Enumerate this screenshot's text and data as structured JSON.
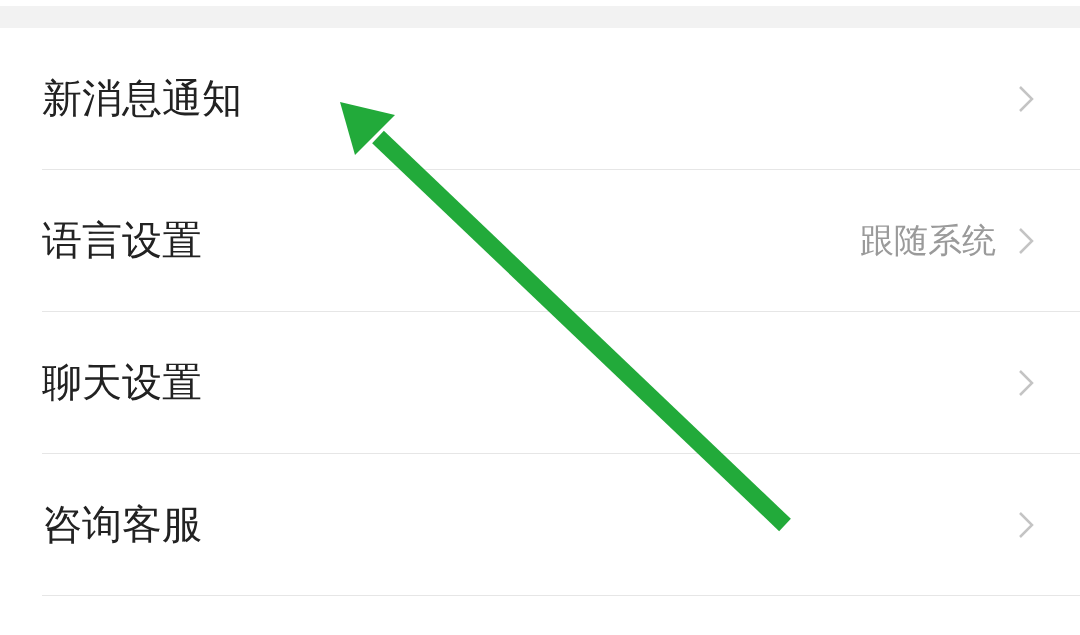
{
  "settings": [
    {
      "label": "新消息通知"
    },
    {
      "label": "语言设置",
      "value": "跟随系统"
    },
    {
      "label": "聊天设置"
    },
    {
      "label": "咨询客服"
    }
  ]
}
